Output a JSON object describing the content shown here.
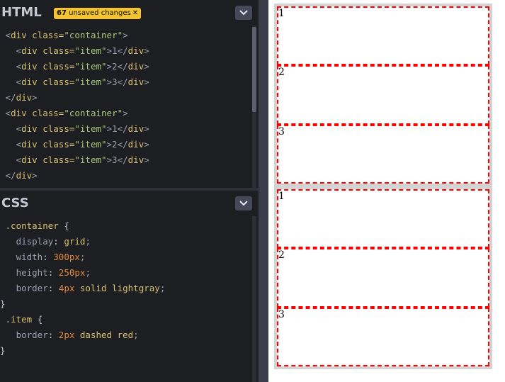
{
  "html_panel": {
    "title": "HTML",
    "badge_count": "67",
    "badge_text": " unsaved changes",
    "badge_close": "✕"
  },
  "css_panel": {
    "title": "CSS"
  },
  "html_code": [
    [
      "<",
      "div",
      " class=",
      "\"container\"",
      ">"
    ],
    [
      "  <",
      "div",
      " class=",
      "\"item\"",
      ">1</",
      "div",
      ">"
    ],
    [
      "  <",
      "div",
      " class=",
      "\"item\"",
      ">2</",
      "div",
      ">"
    ],
    [
      "  <",
      "div",
      " class=",
      "\"item\"",
      ">3</",
      "div",
      ">"
    ],
    [
      "</",
      "div",
      ">"
    ]
  ],
  "css_code": {
    "container_selector": ".container",
    "item_selector": ".item",
    "open_brace": " {",
    "close_brace": "}",
    "container_rules": [
      {
        "prop": "display",
        "val": "grid"
      },
      {
        "prop": "width",
        "val": "300px"
      },
      {
        "prop": "height",
        "val": "250px"
      },
      {
        "prop": "border",
        "val": "4px solid lightgray"
      }
    ],
    "item_rules": [
      {
        "prop": "border",
        "val": "2px dashed red"
      }
    ]
  },
  "preview": {
    "containers": [
      {
        "items": [
          "1",
          "2",
          "3"
        ]
      },
      {
        "items": [
          "1",
          "2",
          "3"
        ]
      }
    ]
  },
  "colors": {
    "editor_bg": "#1d1e22",
    "badge_bg": "#f4c430",
    "item_border": "red",
    "container_border": "lightgray"
  },
  "icons": {
    "collapse": "chevron-down-icon",
    "badge_close": "close-icon"
  }
}
